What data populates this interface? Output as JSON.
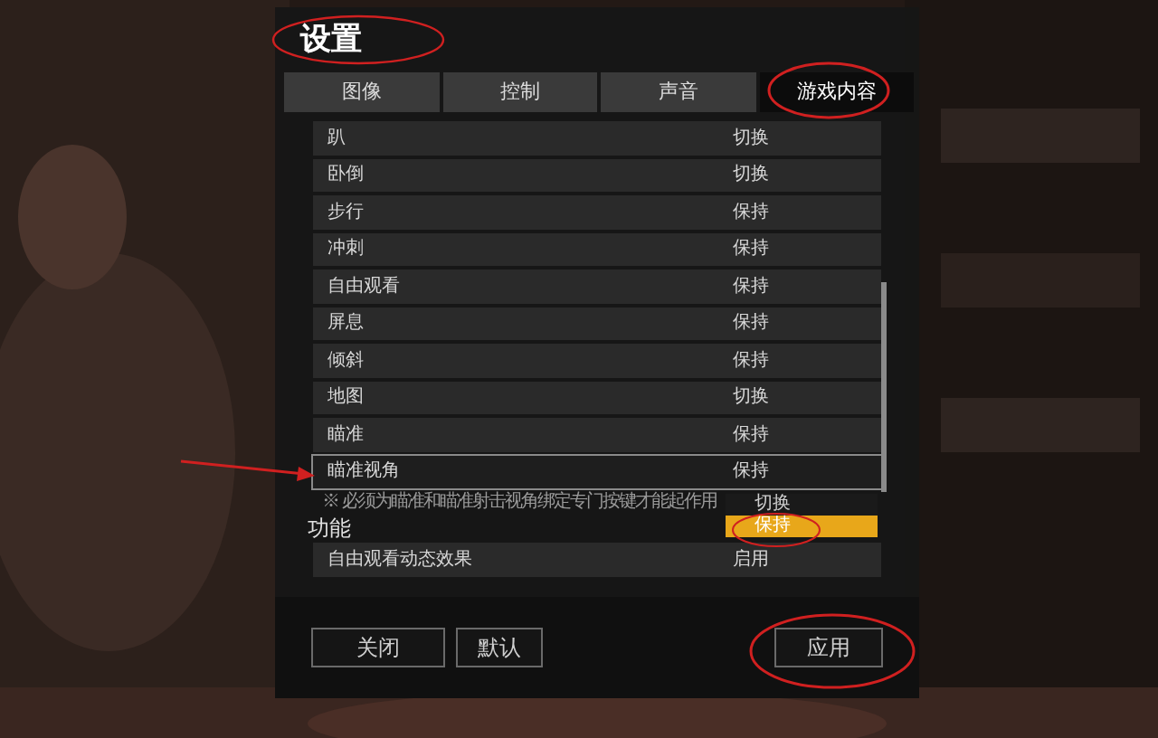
{
  "window": {
    "title": "设置"
  },
  "tabs": [
    {
      "label": "图像",
      "selected": false
    },
    {
      "label": "控制",
      "selected": false
    },
    {
      "label": "声音",
      "selected": false
    },
    {
      "label": "游戏内容",
      "selected": true
    }
  ],
  "settings": [
    {
      "label": "趴",
      "value": "切换",
      "selected": false
    },
    {
      "label": "卧倒",
      "value": "切换",
      "selected": false
    },
    {
      "label": "步行",
      "value": "保持",
      "selected": false
    },
    {
      "label": "冲刺",
      "value": "保持",
      "selected": false
    },
    {
      "label": "自由观看",
      "value": "保持",
      "selected": false
    },
    {
      "label": "屏息",
      "value": "保持",
      "selected": false
    },
    {
      "label": "倾斜",
      "value": "保持",
      "selected": false
    },
    {
      "label": "地图",
      "value": "切换",
      "selected": false
    },
    {
      "label": "瞄准",
      "value": "保持",
      "selected": false
    },
    {
      "label": "瞄准视角",
      "value": "保持",
      "selected": true
    }
  ],
  "note": "※ 必须为瞄准和瞄准射击视角绑定专门按键才能起作用",
  "dropdown": {
    "options": [
      {
        "label": "切换",
        "selected": false
      },
      {
        "label": "保持",
        "selected": true
      }
    ]
  },
  "section": {
    "title": "功能",
    "rows": [
      {
        "label": "自由观看动态效果",
        "value": "启用"
      }
    ]
  },
  "buttons": [
    {
      "label": "关闭",
      "kind": "left"
    },
    {
      "label": "默认",
      "kind": "left"
    },
    {
      "label": "应用",
      "kind": "right"
    }
  ]
}
